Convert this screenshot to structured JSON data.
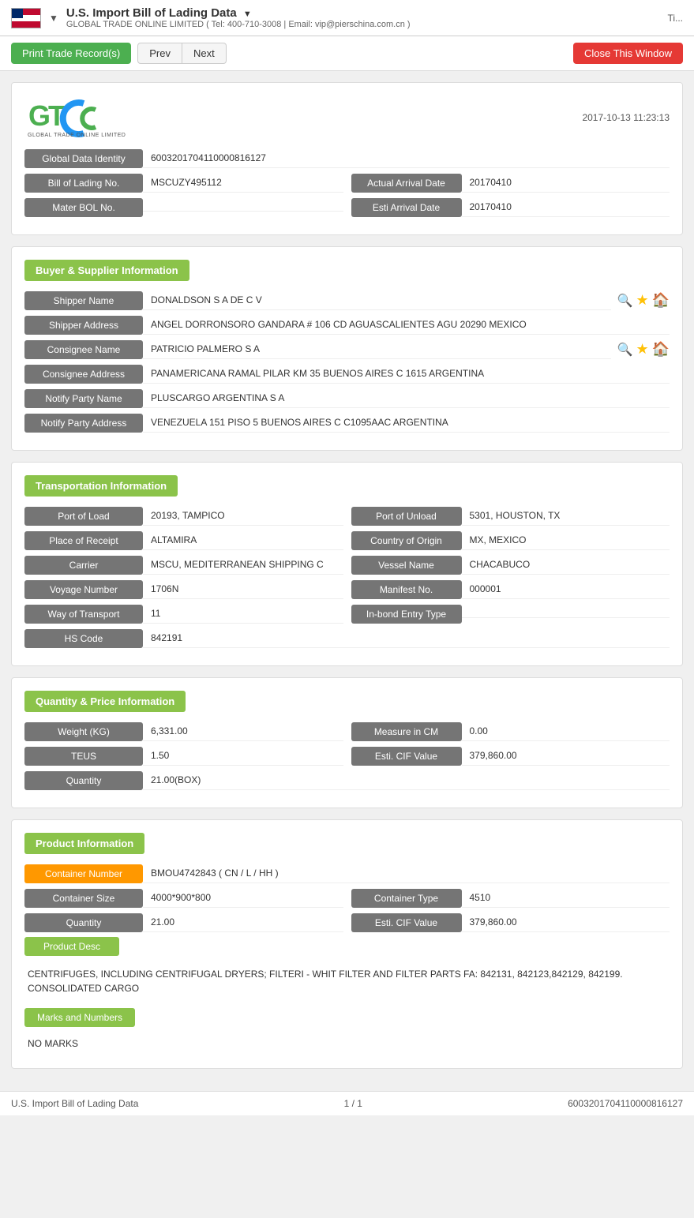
{
  "topbar": {
    "title": "U.S. Import Bill of Lading Data",
    "title_arrow": "▼",
    "subtitle": "GLOBAL TRADE ONLINE LIMITED ( Tel: 400-710-3008 | Email: vip@pierschina.com.cn )",
    "right_text": "Ti...",
    "dropdown_arrow": "▼"
  },
  "toolbar": {
    "print_label": "Print Trade Record(s)",
    "prev_label": "Prev",
    "next_label": "Next",
    "close_label": "Close This Window"
  },
  "logo": {
    "date_time": "2017-10-13 11:23:13",
    "company": "GLOBAL TRADE ONLINE LIMITED"
  },
  "identity": {
    "global_data_label": "Global Data Identity",
    "global_data_value": "6003201704110000816127",
    "bol_label": "Bill of Lading No.",
    "bol_value": "MSCUZY495112",
    "actual_arrival_label": "Actual Arrival Date",
    "actual_arrival_value": "20170410",
    "mater_bol_label": "Mater BOL No.",
    "mater_bol_value": "",
    "esti_arrival_label": "Esti Arrival Date",
    "esti_arrival_value": "20170410"
  },
  "buyer_supplier": {
    "section_title": "Buyer & Supplier Information",
    "shipper_name_label": "Shipper Name",
    "shipper_name_value": "DONALDSON S A DE C V",
    "shipper_address_label": "Shipper Address",
    "shipper_address_value": "ANGEL DORRONSORO GANDARA # 106 CD AGUASCALIENTES AGU 20290 MEXICO",
    "consignee_name_label": "Consignee Name",
    "consignee_name_value": "PATRICIO PALMERO S A",
    "consignee_address_label": "Consignee Address",
    "consignee_address_value": "PANAMERICANA RAMAL PILAR KM 35 BUENOS AIRES C 1615 ARGENTINA",
    "notify_party_name_label": "Notify Party Name",
    "notify_party_name_value": "PLUSCARGO ARGENTINA S A",
    "notify_party_address_label": "Notify Party Address",
    "notify_party_address_value": "VENEZUELA 151 PISO 5 BUENOS AIRES C C1095AAC ARGENTINA"
  },
  "transportation": {
    "section_title": "Transportation Information",
    "port_of_load_label": "Port of Load",
    "port_of_load_value": "20193, TAMPICO",
    "port_of_unload_label": "Port of Unload",
    "port_of_unload_value": "5301, HOUSTON, TX",
    "place_of_receipt_label": "Place of Receipt",
    "place_of_receipt_value": "ALTAMIRA",
    "country_of_origin_label": "Country of Origin",
    "country_of_origin_value": "MX, MEXICO",
    "carrier_label": "Carrier",
    "carrier_value": "MSCU, MEDITERRANEAN SHIPPING C",
    "vessel_name_label": "Vessel Name",
    "vessel_name_value": "CHACABUCO",
    "voyage_number_label": "Voyage Number",
    "voyage_number_value": "1706N",
    "manifest_no_label": "Manifest No.",
    "manifest_no_value": "000001",
    "way_of_transport_label": "Way of Transport",
    "way_of_transport_value": "11",
    "inbond_entry_label": "In-bond Entry Type",
    "inbond_entry_value": "",
    "hs_code_label": "HS Code",
    "hs_code_value": "842191"
  },
  "quantity_price": {
    "section_title": "Quantity & Price Information",
    "weight_label": "Weight (KG)",
    "weight_value": "6,331.00",
    "measure_label": "Measure in CM",
    "measure_value": "0.00",
    "teus_label": "TEUS",
    "teus_value": "1.50",
    "esti_cif_label": "Esti. CIF Value",
    "esti_cif_value": "379,860.00",
    "quantity_label": "Quantity",
    "quantity_value": "21.00(BOX)"
  },
  "product": {
    "section_title": "Product Information",
    "container_number_label": "Container Number",
    "container_number_value": "BMOU4742843 ( CN / L / HH )",
    "container_size_label": "Container Size",
    "container_size_value": "4000*900*800",
    "container_type_label": "Container Type",
    "container_type_value": "4510",
    "quantity_label": "Quantity",
    "quantity_value": "21.00",
    "esti_cif_label": "Esti. CIF Value",
    "esti_cif_value": "379,860.00",
    "product_desc_label": "Product Desc",
    "product_desc_text": "CENTRIFUGES, INCLUDING CENTRIFUGAL DRYERS; FILTERI - WHIT FILTER AND FILTER PARTS FA: 842131, 842123,842129, 842199.\nCONSOLIDATED CARGO",
    "marks_label": "Marks and Numbers",
    "marks_text": "NO MARKS"
  },
  "footer": {
    "left_text": "U.S. Import Bill of Lading Data",
    "center_text": "1 / 1",
    "right_text": "6003201704110000816127"
  }
}
